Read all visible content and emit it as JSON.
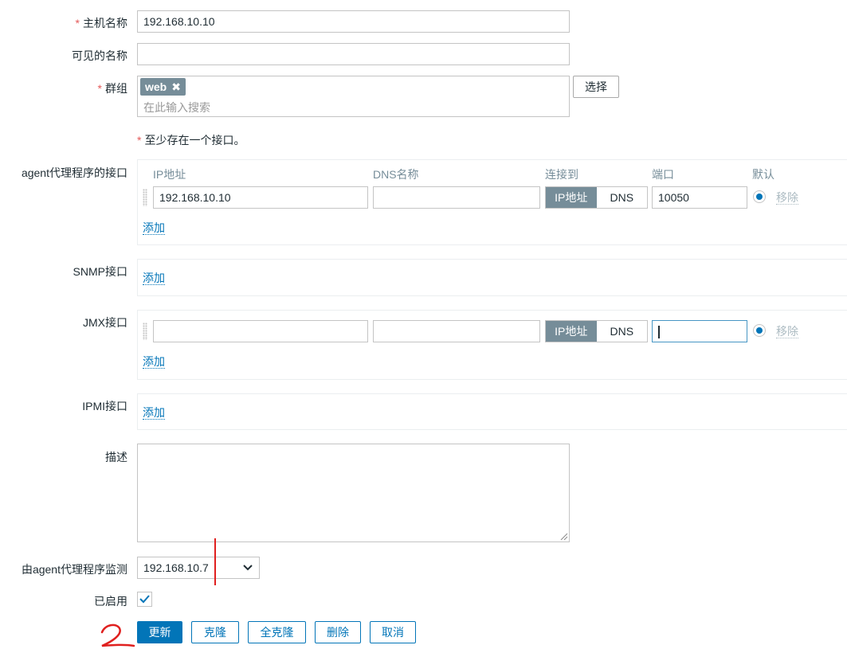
{
  "form": {
    "host_name": {
      "label": "主机名称",
      "value": "192.168.10.10"
    },
    "visible_name": {
      "label": "可见的名称",
      "value": ""
    },
    "groups": {
      "label": "群组",
      "tag": "web",
      "placeholder": "在此输入搜索",
      "select_button": "选择"
    },
    "interface_note": "至少存在一个接口。",
    "agent": {
      "label": "agent代理程序的接口",
      "headers": {
        "ip": "IP地址",
        "dns": "DNS名称",
        "connect": "连接到",
        "port": "端口",
        "default": "默认"
      },
      "row": {
        "ip": "192.168.10.10",
        "dns": "",
        "connect_ip": "IP地址",
        "connect_dns": "DNS",
        "port": "10050",
        "remove": "移除"
      },
      "add": "添加"
    },
    "snmp": {
      "label": "SNMP接口",
      "add": "添加"
    },
    "jmx": {
      "label": "JMX接口",
      "row": {
        "ip": "",
        "dns": "",
        "connect_ip": "IP地址",
        "connect_dns": "DNS",
        "port": "",
        "remove": "移除"
      },
      "add": "添加"
    },
    "ipmi": {
      "label": "IPMI接口",
      "add": "添加"
    },
    "description": {
      "label": "描述",
      "value": ""
    },
    "proxy": {
      "label": "由agent代理程序监测",
      "value": "192.168.10.7"
    },
    "enabled": {
      "label": "已启用",
      "checked": true
    }
  },
  "actions": {
    "update": "更新",
    "clone": "克隆",
    "full_clone": "全克隆",
    "delete": "删除",
    "cancel": "取消"
  },
  "colors": {
    "accent": "#0275b8",
    "annotation": "#e0201f"
  }
}
